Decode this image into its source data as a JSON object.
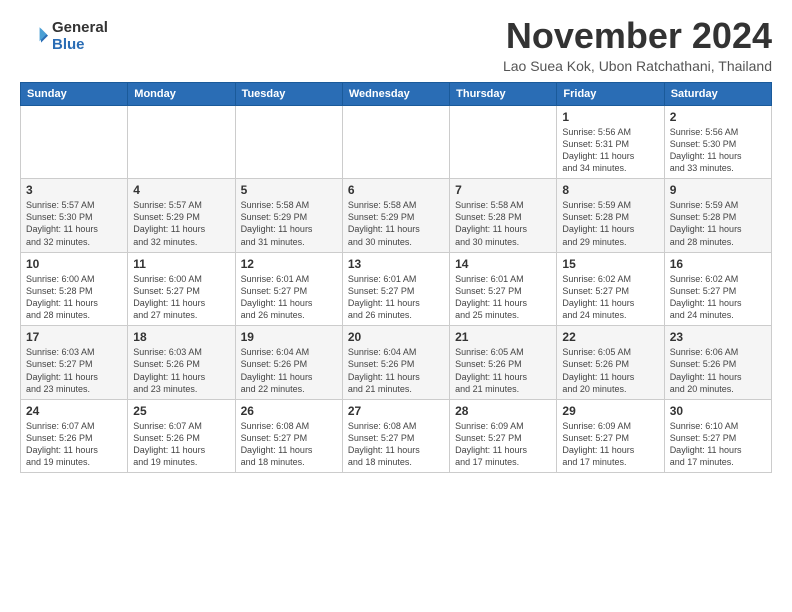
{
  "header": {
    "logo_general": "General",
    "logo_blue": "Blue",
    "month": "November 2024",
    "location": "Lao Suea Kok, Ubon Ratchathani, Thailand"
  },
  "weekdays": [
    "Sunday",
    "Monday",
    "Tuesday",
    "Wednesday",
    "Thursday",
    "Friday",
    "Saturday"
  ],
  "weeks": [
    [
      {
        "day": "",
        "info": ""
      },
      {
        "day": "",
        "info": ""
      },
      {
        "day": "",
        "info": ""
      },
      {
        "day": "",
        "info": ""
      },
      {
        "day": "",
        "info": ""
      },
      {
        "day": "1",
        "info": "Sunrise: 5:56 AM\nSunset: 5:31 PM\nDaylight: 11 hours\nand 34 minutes."
      },
      {
        "day": "2",
        "info": "Sunrise: 5:56 AM\nSunset: 5:30 PM\nDaylight: 11 hours\nand 33 minutes."
      }
    ],
    [
      {
        "day": "3",
        "info": "Sunrise: 5:57 AM\nSunset: 5:30 PM\nDaylight: 11 hours\nand 32 minutes."
      },
      {
        "day": "4",
        "info": "Sunrise: 5:57 AM\nSunset: 5:29 PM\nDaylight: 11 hours\nand 32 minutes."
      },
      {
        "day": "5",
        "info": "Sunrise: 5:58 AM\nSunset: 5:29 PM\nDaylight: 11 hours\nand 31 minutes."
      },
      {
        "day": "6",
        "info": "Sunrise: 5:58 AM\nSunset: 5:29 PM\nDaylight: 11 hours\nand 30 minutes."
      },
      {
        "day": "7",
        "info": "Sunrise: 5:58 AM\nSunset: 5:28 PM\nDaylight: 11 hours\nand 30 minutes."
      },
      {
        "day": "8",
        "info": "Sunrise: 5:59 AM\nSunset: 5:28 PM\nDaylight: 11 hours\nand 29 minutes."
      },
      {
        "day": "9",
        "info": "Sunrise: 5:59 AM\nSunset: 5:28 PM\nDaylight: 11 hours\nand 28 minutes."
      }
    ],
    [
      {
        "day": "10",
        "info": "Sunrise: 6:00 AM\nSunset: 5:28 PM\nDaylight: 11 hours\nand 28 minutes."
      },
      {
        "day": "11",
        "info": "Sunrise: 6:00 AM\nSunset: 5:27 PM\nDaylight: 11 hours\nand 27 minutes."
      },
      {
        "day": "12",
        "info": "Sunrise: 6:01 AM\nSunset: 5:27 PM\nDaylight: 11 hours\nand 26 minutes."
      },
      {
        "day": "13",
        "info": "Sunrise: 6:01 AM\nSunset: 5:27 PM\nDaylight: 11 hours\nand 26 minutes."
      },
      {
        "day": "14",
        "info": "Sunrise: 6:01 AM\nSunset: 5:27 PM\nDaylight: 11 hours\nand 25 minutes."
      },
      {
        "day": "15",
        "info": "Sunrise: 6:02 AM\nSunset: 5:27 PM\nDaylight: 11 hours\nand 24 minutes."
      },
      {
        "day": "16",
        "info": "Sunrise: 6:02 AM\nSunset: 5:27 PM\nDaylight: 11 hours\nand 24 minutes."
      }
    ],
    [
      {
        "day": "17",
        "info": "Sunrise: 6:03 AM\nSunset: 5:27 PM\nDaylight: 11 hours\nand 23 minutes."
      },
      {
        "day": "18",
        "info": "Sunrise: 6:03 AM\nSunset: 5:26 PM\nDaylight: 11 hours\nand 23 minutes."
      },
      {
        "day": "19",
        "info": "Sunrise: 6:04 AM\nSunset: 5:26 PM\nDaylight: 11 hours\nand 22 minutes."
      },
      {
        "day": "20",
        "info": "Sunrise: 6:04 AM\nSunset: 5:26 PM\nDaylight: 11 hours\nand 21 minutes."
      },
      {
        "day": "21",
        "info": "Sunrise: 6:05 AM\nSunset: 5:26 PM\nDaylight: 11 hours\nand 21 minutes."
      },
      {
        "day": "22",
        "info": "Sunrise: 6:05 AM\nSunset: 5:26 PM\nDaylight: 11 hours\nand 20 minutes."
      },
      {
        "day": "23",
        "info": "Sunrise: 6:06 AM\nSunset: 5:26 PM\nDaylight: 11 hours\nand 20 minutes."
      }
    ],
    [
      {
        "day": "24",
        "info": "Sunrise: 6:07 AM\nSunset: 5:26 PM\nDaylight: 11 hours\nand 19 minutes."
      },
      {
        "day": "25",
        "info": "Sunrise: 6:07 AM\nSunset: 5:26 PM\nDaylight: 11 hours\nand 19 minutes."
      },
      {
        "day": "26",
        "info": "Sunrise: 6:08 AM\nSunset: 5:27 PM\nDaylight: 11 hours\nand 18 minutes."
      },
      {
        "day": "27",
        "info": "Sunrise: 6:08 AM\nSunset: 5:27 PM\nDaylight: 11 hours\nand 18 minutes."
      },
      {
        "day": "28",
        "info": "Sunrise: 6:09 AM\nSunset: 5:27 PM\nDaylight: 11 hours\nand 17 minutes."
      },
      {
        "day": "29",
        "info": "Sunrise: 6:09 AM\nSunset: 5:27 PM\nDaylight: 11 hours\nand 17 minutes."
      },
      {
        "day": "30",
        "info": "Sunrise: 6:10 AM\nSunset: 5:27 PM\nDaylight: 11 hours\nand 17 minutes."
      }
    ]
  ]
}
